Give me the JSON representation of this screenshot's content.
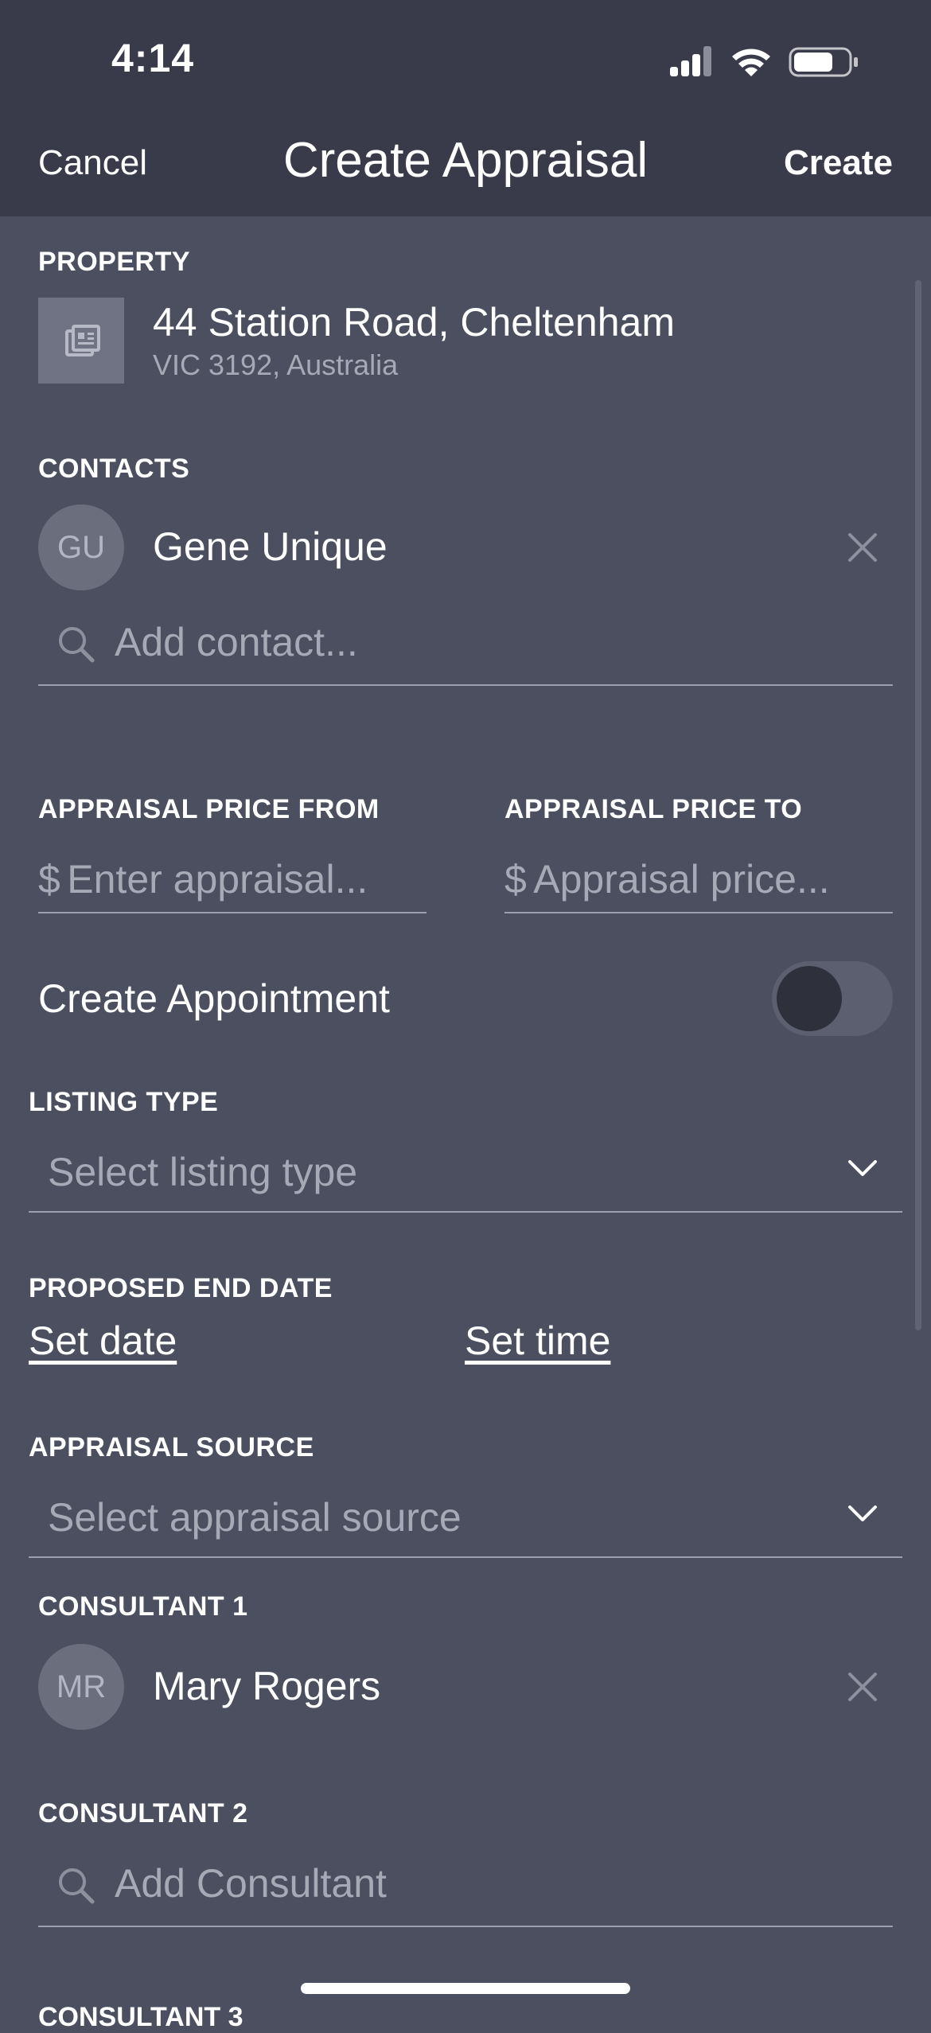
{
  "status_bar": {
    "time": "4:14"
  },
  "nav": {
    "cancel_label": "Cancel",
    "title": "Create Appraisal",
    "create_label": "Create"
  },
  "property": {
    "label": "PROPERTY",
    "address_line1": "44 Station Road, Cheltenham",
    "address_line2": "VIC 3192, Australia"
  },
  "contacts": {
    "label": "CONTACTS",
    "items": [
      {
        "initials": "GU",
        "name": "Gene Unique"
      }
    ],
    "add_placeholder": "Add contact..."
  },
  "price": {
    "from_label": "APPRAISAL PRICE FROM",
    "from_currency": "$",
    "from_placeholder": "Enter appraisal...",
    "to_label": "APPRAISAL PRICE TO",
    "to_currency": "$",
    "to_placeholder": "Appraisal price..."
  },
  "appointment": {
    "label": "Create Appointment",
    "enabled": false
  },
  "listing_type": {
    "label": "LISTING TYPE",
    "placeholder": "Select listing type"
  },
  "proposed_end_date": {
    "label": "PROPOSED END DATE",
    "set_date_label": "Set date",
    "set_time_label": "Set time"
  },
  "appraisal_source": {
    "label": "APPRAISAL SOURCE",
    "placeholder": "Select appraisal source"
  },
  "consultant1": {
    "label": "CONSULTANT 1",
    "initials": "MR",
    "name": "Mary Rogers"
  },
  "consultant2": {
    "label": "CONSULTANT 2",
    "placeholder": "Add Consultant"
  },
  "consultant3": {
    "label": "CONSULTANT 3"
  },
  "colors": {
    "header_bg": "#393b4a",
    "body_bg": "#4b4f5f",
    "muted_text": "#a6a9b6"
  },
  "icons": [
    "cellular-signal-icon",
    "wifi-icon",
    "battery-icon",
    "property-image-icon",
    "close-icon",
    "search-icon",
    "chevron-down-icon"
  ]
}
